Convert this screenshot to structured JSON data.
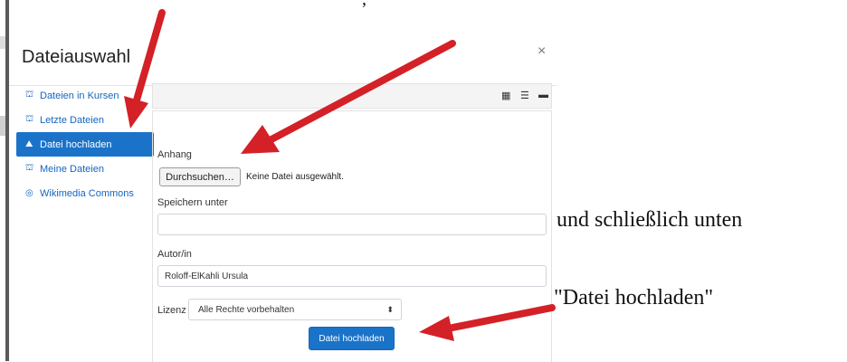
{
  "dialog": {
    "title": "Dateiauswahl",
    "close": "×"
  },
  "sidebar": {
    "items": [
      {
        "label": "Dateien in Kursen",
        "icon": "repository-icon"
      },
      {
        "label": "Letzte Dateien",
        "icon": "repository-icon"
      },
      {
        "label": "Datei hochladen",
        "icon": "upload-icon",
        "active": true
      },
      {
        "label": "Meine Dateien",
        "icon": "repository-icon"
      },
      {
        "label": "Wikimedia Commons",
        "icon": "wikimedia-icon"
      }
    ]
  },
  "toolbar": {
    "views": [
      "grid-view-icon",
      "list-view-icon",
      "folder-view-icon"
    ]
  },
  "form": {
    "attachment_label": "Anhang",
    "browse_label": "Durchsuchen…",
    "no_file_text": "Keine Datei ausgewählt.",
    "save_as_label": "Speichern unter",
    "save_as_value": "",
    "author_label": "Autor/in",
    "author_value": "Roloff-ElKahli Ursula",
    "license_label": "Lizenz",
    "license_value": "Alle Rechte vorbehalten",
    "upload_label": "Datei hochladen"
  },
  "annotations": {
    "top_fragment": ",",
    "line1": "und schließlich unten",
    "line2": "\"Datei hochladen\""
  },
  "colors": {
    "accent": "#1a73c9",
    "link": "#1565c0",
    "arrow": "#d42027"
  }
}
